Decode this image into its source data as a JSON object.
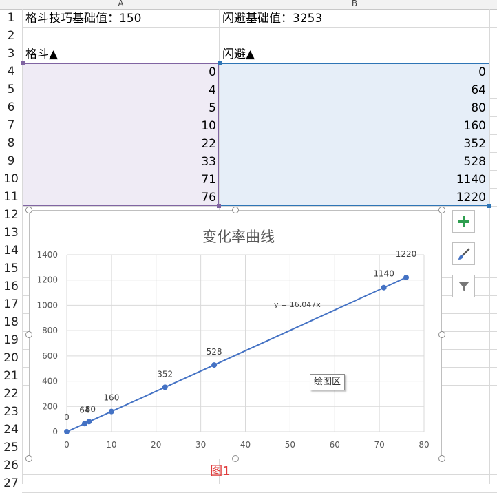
{
  "columns": [
    "A",
    "B"
  ],
  "row_numbers": [
    "1",
    "2",
    "3",
    "4",
    "5",
    "6",
    "7",
    "8",
    "9",
    "10",
    "11",
    "12",
    "13",
    "14",
    "15",
    "16",
    "17",
    "18",
    "19",
    "20",
    "21",
    "22",
    "23",
    "24",
    "25",
    "26",
    "27"
  ],
  "cells": {
    "a1": "格斗技巧基础值：150",
    "b1": "闪避基础值：3253",
    "a3": "格斗▲",
    "b3": "闪避▲"
  },
  "data_rows": [
    {
      "a": "0",
      "b": "0"
    },
    {
      "a": "4",
      "b": "64"
    },
    {
      "a": "5",
      "b": "80"
    },
    {
      "a": "10",
      "b": "160"
    },
    {
      "a": "22",
      "b": "352"
    },
    {
      "a": "33",
      "b": "528"
    },
    {
      "a": "71",
      "b": "1140"
    },
    {
      "a": "76",
      "b": "1220"
    }
  ],
  "chart_data": {
    "type": "scatter",
    "title": "变化率曲线",
    "x": [
      0,
      4,
      5,
      10,
      22,
      33,
      71,
      76
    ],
    "y": [
      0,
      64,
      80,
      160,
      352,
      528,
      1140,
      1220
    ],
    "data_labels": [
      "0",
      "64",
      "80",
      "160",
      "352",
      "528",
      "1140",
      "1220"
    ],
    "x_ticks": [
      "0",
      "10",
      "20",
      "30",
      "40",
      "50",
      "60",
      "70",
      "80"
    ],
    "y_ticks": [
      "0",
      "200",
      "400",
      "600",
      "800",
      "1000",
      "1200",
      "1400"
    ],
    "xlim": [
      0,
      80
    ],
    "ylim": [
      0,
      1400
    ],
    "trendline_label": "y = 16.047x",
    "trendline_slope": 16.047,
    "grid": true,
    "series_color": "#4472c4"
  },
  "tooltip": "绘图区",
  "caption": "图1",
  "chart_buttons": [
    "plus-icon",
    "brush-icon",
    "filter-icon"
  ]
}
